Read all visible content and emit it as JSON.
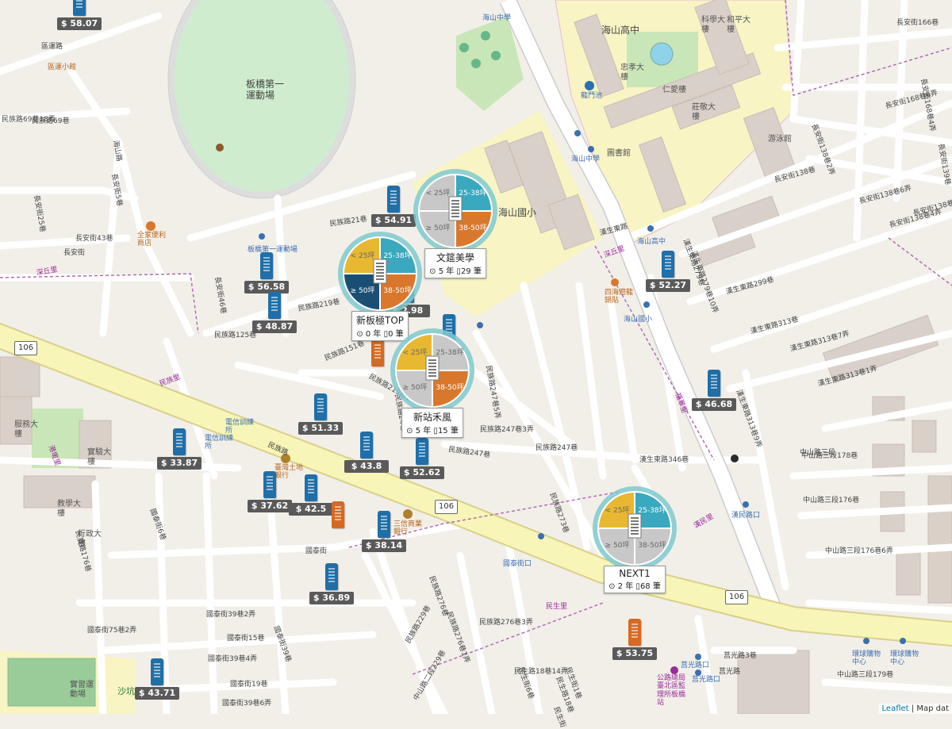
{
  "map": {
    "places": [
      {
        "key": "stadium",
        "text": "板橋第一\n運動場"
      },
      {
        "key": "school_high",
        "text": "海山高中"
      },
      {
        "key": "school_elem",
        "text": "海山國小"
      },
      {
        "key": "library",
        "text": "圖書館"
      },
      {
        "key": "pool",
        "text": "游泳館"
      },
      {
        "key": "bldg1",
        "text": "仁愛樓"
      },
      {
        "key": "bldg2",
        "text": "忠孝大\n樓"
      },
      {
        "key": "bldg3",
        "text": "莊敬大\n樓"
      },
      {
        "key": "bldg4",
        "text": "科學大\n樓"
      },
      {
        "key": "bldg5",
        "text": "和平大\n樓"
      },
      {
        "key": "pond",
        "text": "龍門池"
      },
      {
        "key": "rest1",
        "text": "四海遊龍\n鍋貼"
      },
      {
        "key": "rest2",
        "text": "區運小館"
      },
      {
        "key": "store1",
        "text": "全家便利\n商店"
      },
      {
        "key": "bank1",
        "text": "臺灣土地\n銀行"
      },
      {
        "key": "bank2",
        "text": "三信商業\n銀行"
      },
      {
        "key": "train1",
        "text": "電信訓練\n所"
      },
      {
        "key": "train2",
        "text": "電信訓練\n所"
      },
      {
        "key": "bldg6",
        "text": "服務大\n樓"
      },
      {
        "key": "bldg7",
        "text": "實驗大\n樓"
      },
      {
        "key": "bldg8",
        "text": "教學大\n樓"
      },
      {
        "key": "bldg9",
        "text": "行政大\n樓"
      },
      {
        "key": "field",
        "text": "實習運\n動場"
      },
      {
        "key": "sand",
        "text": "沙坑"
      },
      {
        "key": "mall1",
        "text": "環球購物\n中心"
      },
      {
        "key": "mall2",
        "text": "環球購物\n中心"
      },
      {
        "key": "hospital",
        "text": "公路總局\n臺北區監\n理所板橋\n站"
      }
    ],
    "roads": [
      "民族路69巷18弄",
      "海山路",
      "長安街",
      "長安街25巷",
      "長安街43巷",
      "長安街5巷",
      "民族路21巷",
      "民族路125巷",
      "長安街46巷",
      "民族路219巷",
      "民族路151巷",
      "民族路219巷1弄",
      "民族路",
      "民族路24巷",
      "民族路247巷",
      "民族路247巷3弄",
      "民族路247巷5弄",
      "民族路273巷",
      "民族路276巷",
      "民族路276巷1弄",
      "民族路276巷3弄",
      "民族路229巷",
      "民族路247巷",
      "國泰街",
      "國泰街6巷",
      "國泰街39巷2弄",
      "國泰街39巷4弄",
      "國泰街39巷6弄",
      "國泰街39巷",
      "國泰街75巷2弄",
      "民族路176巷",
      "中山路二段229巷",
      "民生街",
      "民生街6巷",
      "民生街1巷",
      "民生路18巷14弄",
      "民生路18巷",
      "漢生東路",
      "漢生東路279巷",
      "漢生東路279巷10弄",
      "漢生東路299巷",
      "漢生東路313巷",
      "漢生東路313巷7弄",
      "漢生東路313巷1弄",
      "漢生東路346巷",
      "漢生東路313巷9弄",
      "長安街138巷",
      "長安街138巷6弄",
      "長安街138巷4弄",
      "長安街166巷",
      "長安街168巷6弄",
      "長安街168巷4弄",
      "長安街138巷8弄",
      "長安街138巷2弄",
      "長安街139巷",
      "中山路三段",
      "中山路三段178巷",
      "中山路三段176巷",
      "中山路三段176巷6弄",
      "中山路三段179巷",
      "莒光路",
      "莒光路3巷",
      "國泰街15巷",
      "國泰街19巷",
      "區運路",
      "民族路69巷"
    ],
    "shields": [
      "106",
      "106",
      "106"
    ],
    "stations": [
      "海山中學",
      "海山中學",
      "海山高中",
      "海山國小",
      "漢民路口",
      "國泰街口",
      "莒光路口",
      "莒光路口",
      "板橋第一運動場"
    ],
    "villages": [
      "深丘里",
      "深丘里",
      "民族里",
      "福翠里",
      "民生里",
      "港墘里",
      "漢民里"
    ],
    "markers": [
      {
        "price": "$ 58.07",
        "color": "blue"
      },
      {
        "price": "$ 54.91",
        "color": "blue"
      },
      {
        "price": "$ 56.58",
        "color": "blue"
      },
      {
        "price": "$ 48.87",
        "color": "blue"
      },
      {
        "price": "$ 51.33",
        "color": "blue"
      },
      {
        "price": "$ 33.87",
        "color": "blue"
      },
      {
        "price": "$ 43.8",
        "color": "blue"
      },
      {
        "price": "$ 52.62",
        "color": "blue"
      },
      {
        "price": "$ 37.62",
        "color": "blue"
      },
      {
        "price": "$ 42.5",
        "color": "blue"
      },
      {
        "price": "$ 38.14",
        "color": "blue"
      },
      {
        "price": "$ 36.89",
        "color": "blue"
      },
      {
        "price": "$ 43.71",
        "color": "blue"
      },
      {
        "price": "$ 52.27",
        "color": "blue"
      },
      {
        "price": "$ 46.68",
        "color": "blue"
      },
      {
        "price": "$ 53.75",
        "color": "orange"
      },
      {
        "price": "",
        "color": "orange"
      },
      {
        "price": "",
        "color": "orange"
      },
      {
        "price": "",
        "color": "blue"
      },
      {
        "price": "$ 2.98",
        "color": "blue"
      }
    ],
    "clusters": [
      {
        "name": "文筵美學",
        "years": "5 年",
        "count": "29 筆",
        "quadrants": [
          "25-38坪",
          "38-50坪",
          "≥ 50坪",
          "< 25坪"
        ],
        "colors": [
          "#3aa8be",
          "#d9782d",
          "#c8c8c8",
          "#c8c8c8"
        ]
      },
      {
        "name": "新板極TOP",
        "years": "0 年",
        "count": "0 筆",
        "quadrants": [
          "25-38坪",
          "38-50坪",
          "≥ 50坪",
          "< 25坪"
        ],
        "colors": [
          "#3aa8be",
          "#d9782d",
          "#1a4f74",
          "#e8b830"
        ]
      },
      {
        "name": "新站禾風",
        "years": "5 年",
        "count": "15 筆",
        "quadrants": [
          "25-38坪",
          "38-50坪",
          "≥ 50坪",
          "< 25坪"
        ],
        "colors": [
          "#c8c8c8",
          "#d9782d",
          "#c8c8c8",
          "#e8b830"
        ]
      },
      {
        "name": "NEXT1",
        "years": "2 年",
        "count": "68 筆",
        "quadrants": [
          "25-38坪",
          "38-50坪",
          "≥ 50坪",
          "< 25坪"
        ],
        "colors": [
          "#3aa8be",
          "#c8c8c8",
          "#c8c8c8",
          "#e8b830"
        ]
      }
    ],
    "clock_icon": "clock-icon",
    "doc_icon": "document-icon"
  },
  "attribution": {
    "leaflet": "Leaflet",
    "sep": " | ",
    "rest": "Map dat"
  }
}
